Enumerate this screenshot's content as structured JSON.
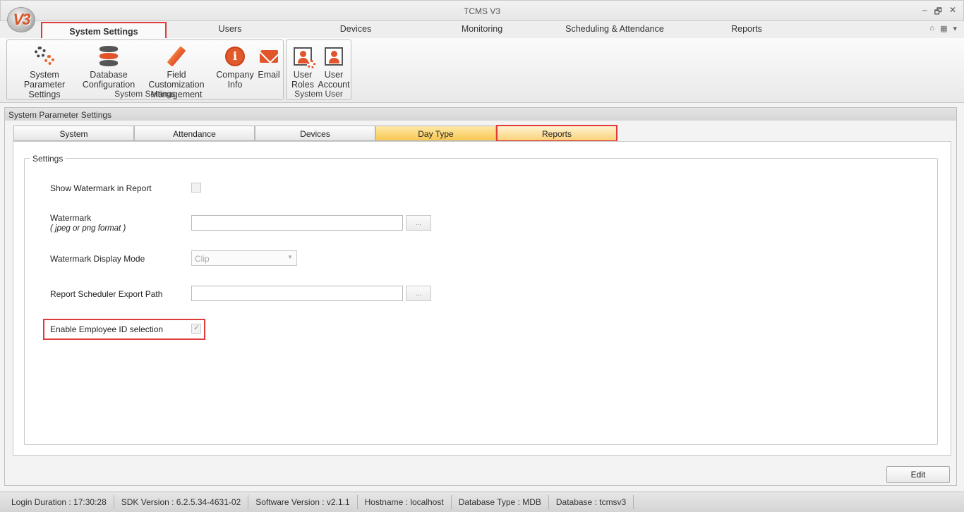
{
  "window": {
    "title": "TCMS V3",
    "logo_text": "V3",
    "controls": [
      "‒",
      "🗗",
      "✕"
    ]
  },
  "ribbon_tabs": [
    {
      "label": "System Settings"
    },
    {
      "label": "Users"
    },
    {
      "label": "Devices"
    },
    {
      "label": "Monitoring"
    },
    {
      "label": "Scheduling & Attendance"
    },
    {
      "label": "Reports"
    }
  ],
  "ribbon_right": [
    "⌂",
    "▦",
    "▾"
  ],
  "ribbon": {
    "system_settings": {
      "group_label": "System Settings",
      "buttons": [
        {
          "label1": "System Parameter",
          "label2": "Settings",
          "icon": "gears-icon"
        },
        {
          "label1": "Database",
          "label2": "Configuration",
          "icon": "database-icon"
        },
        {
          "label1": "Field Customization",
          "label2": "Management",
          "icon": "pencil-icon"
        },
        {
          "label1": "Company",
          "label2": "Info",
          "icon": "info-icon"
        },
        {
          "label1": "Email",
          "label2": "",
          "icon": "email-icon"
        }
      ]
    },
    "system_user": {
      "group_label": "System User",
      "buttons": [
        {
          "label1": "User",
          "label2": "Roles",
          "icon": "user-roles-icon"
        },
        {
          "label1": "User",
          "label2": "Account",
          "icon": "user-account-icon"
        }
      ]
    }
  },
  "panel": {
    "title": "System Parameter Settings",
    "tabs": [
      "System",
      "Attendance",
      "Devices",
      "Day Type",
      "Reports"
    ],
    "active_tab": "Reports",
    "group_title": "Settings",
    "fields": {
      "show_watermark": {
        "label": "Show Watermark in Report",
        "checked": false
      },
      "watermark": {
        "label": "Watermark",
        "sublabel": "( jpeg or png format )",
        "value": "",
        "browse": "..."
      },
      "display_mode": {
        "label": "Watermark Display Mode",
        "value": "Clip"
      },
      "export_path": {
        "label": "Report Scheduler Export Path",
        "value": "",
        "browse": "..."
      },
      "enable_emp_id": {
        "label": "Enable Employee ID selection",
        "checked": true
      }
    },
    "edit_label": "Edit"
  },
  "status": {
    "login": "Login Duration : 17:30:28",
    "sdk": "SDK Version : 6.2.5.34-4631-02",
    "software": "Software Version : v2.1.1",
    "hostname": "Hostname : localhost",
    "db_type": "Database Type : MDB",
    "database": "Database : tcmsv3"
  },
  "colors": {
    "highlight": "#e03a3a",
    "accent_orange": "#e0552b",
    "tab_yellow": "#f7c752"
  }
}
